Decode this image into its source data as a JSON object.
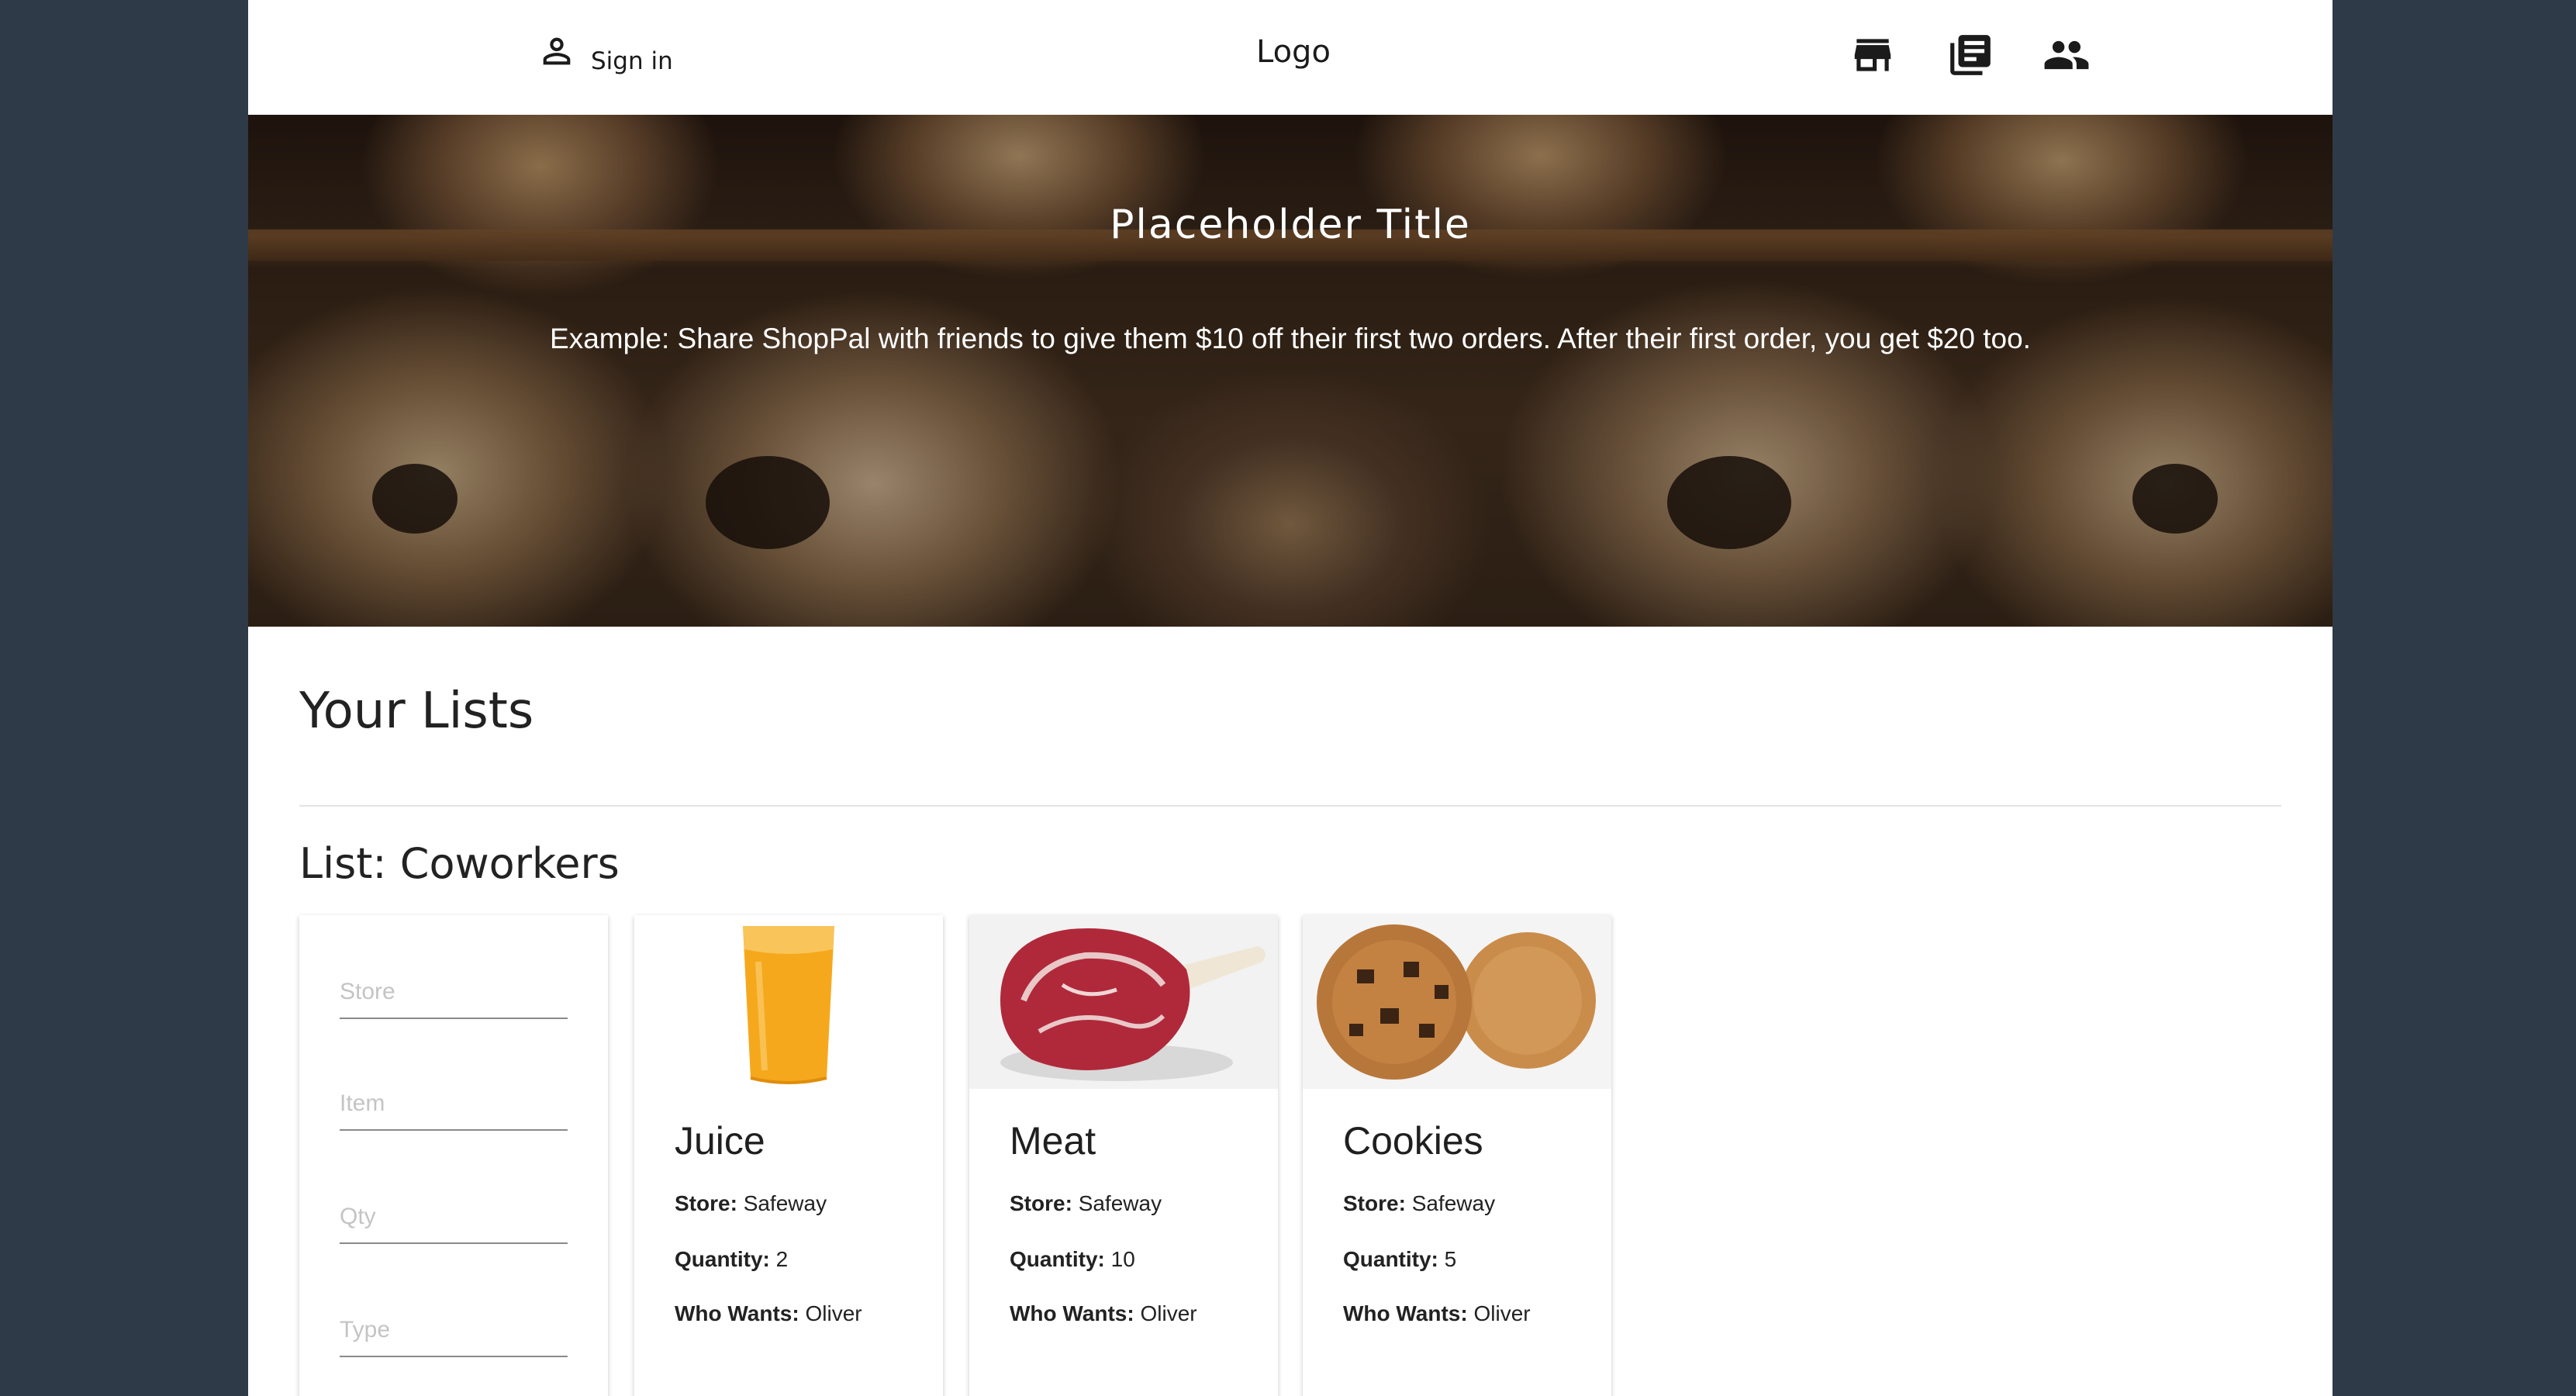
{
  "header": {
    "sign_in_label": "Sign in",
    "logo_text": "Logo",
    "nav_icons": [
      "store-icon",
      "news-icon",
      "people-icon"
    ]
  },
  "hero": {
    "title": "Placeholder Title",
    "subtitle": "Example: Share ShopPal with friends to give them $10 off their first two orders. After their first order, you get $20 too."
  },
  "main": {
    "section_title": "Your Lists",
    "list_title": "List: Coworkers",
    "form": {
      "store_placeholder": "Store",
      "item_placeholder": "Item",
      "qty_placeholder": "Qty",
      "type_placeholder": "Type"
    },
    "labels": {
      "store": "Store:",
      "quantity": "Quantity:",
      "who_wants": "Who Wants:"
    },
    "items": [
      {
        "name": "Juice",
        "store": "Safeway",
        "quantity": "2",
        "who_wants": "Oliver"
      },
      {
        "name": "Meat",
        "store": "Safeway",
        "quantity": "10",
        "who_wants": "Oliver"
      },
      {
        "name": "Cookies",
        "store": "Safeway",
        "quantity": "5",
        "who_wants": "Oliver"
      }
    ]
  },
  "colors": {
    "page_background": "#2e3a47",
    "content_background": "#ffffff",
    "text_primary": "#222222",
    "placeholder": "#c4c4c4"
  }
}
